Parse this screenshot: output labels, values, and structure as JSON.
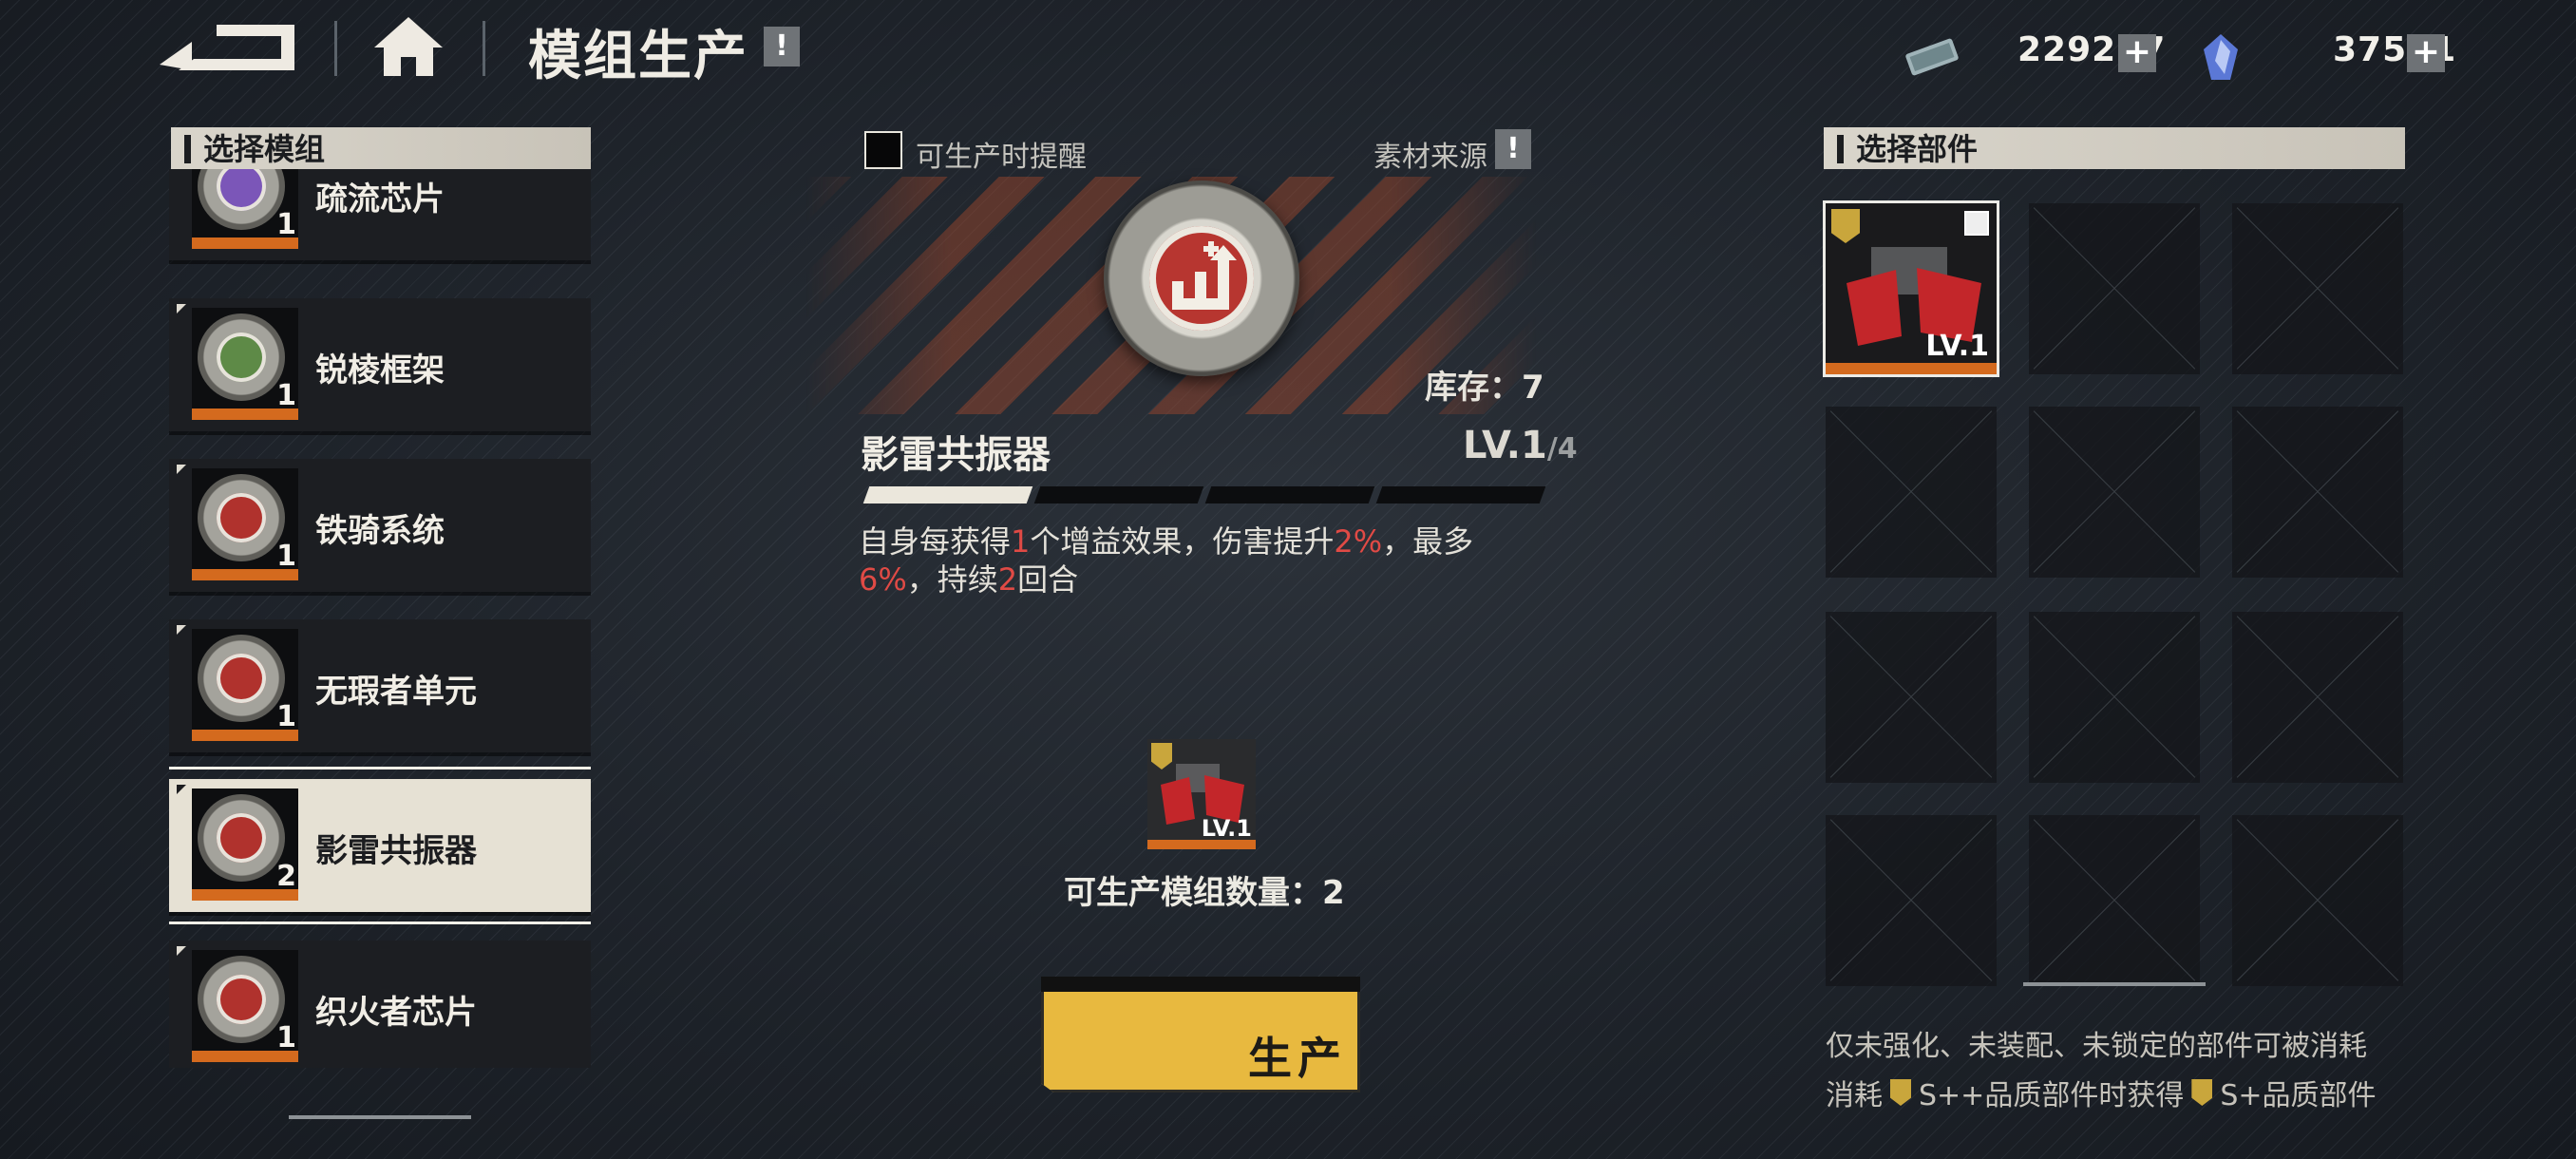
{
  "header": {
    "title": "模组生产",
    "tip_icon": "!",
    "resources": [
      {
        "icon": "ticket-icon",
        "value": "229277"
      },
      {
        "icon": "crystal-icon",
        "value": "37551"
      }
    ],
    "plus": "+"
  },
  "left_panel": {
    "title": "选择模组",
    "modules": [
      {
        "name": "疏流芯片",
        "count": "1"
      },
      {
        "name": "锐棱框架",
        "count": "1"
      },
      {
        "name": "铁骑系统",
        "count": "1"
      },
      {
        "name": "无瑕者单元",
        "count": "1"
      },
      {
        "name": "影雷共振器",
        "count": "2"
      },
      {
        "name": "织火者芯片",
        "count": "1"
      }
    ],
    "selected_index": 4
  },
  "middle": {
    "remind_label": "可生产时提醒",
    "source_label": "素材来源",
    "source_tip": "!",
    "stock": "库存：7",
    "module_name": "影雷共振器",
    "level_current": "LV.1",
    "level_max": "/4",
    "level_progress": 0.25,
    "desc_parts": [
      {
        "text": "自身每获得",
        "red": false
      },
      {
        "text": "1",
        "red": true
      },
      {
        "text": "个增益效果，伤害提升",
        "red": false
      },
      {
        "text": "2%",
        "red": true
      },
      {
        "text": "，最多",
        "red": false
      },
      {
        "text": "6%",
        "red": true
      },
      {
        "text": "，持续",
        "red": false
      },
      {
        "text": "2",
        "red": true
      },
      {
        "text": "回合",
        "red": false
      }
    ],
    "material_level": "LV.1",
    "producible_count": "可生产模组数量：2",
    "produce_button": "生产"
  },
  "right_panel": {
    "title": "选择部件",
    "filled_part_level": "LV.1",
    "note_line1": "仅未强化、未装配、未锁定的部件可被消耗",
    "note_line2_a": "消耗",
    "note_line2_b": "S++品质部件时获得",
    "note_line2_c": "S+品质部件"
  },
  "colors": {
    "accent_orange": "#d46a1e",
    "button_yellow": "#e8b93f",
    "highlight_red": "#e04a45"
  }
}
